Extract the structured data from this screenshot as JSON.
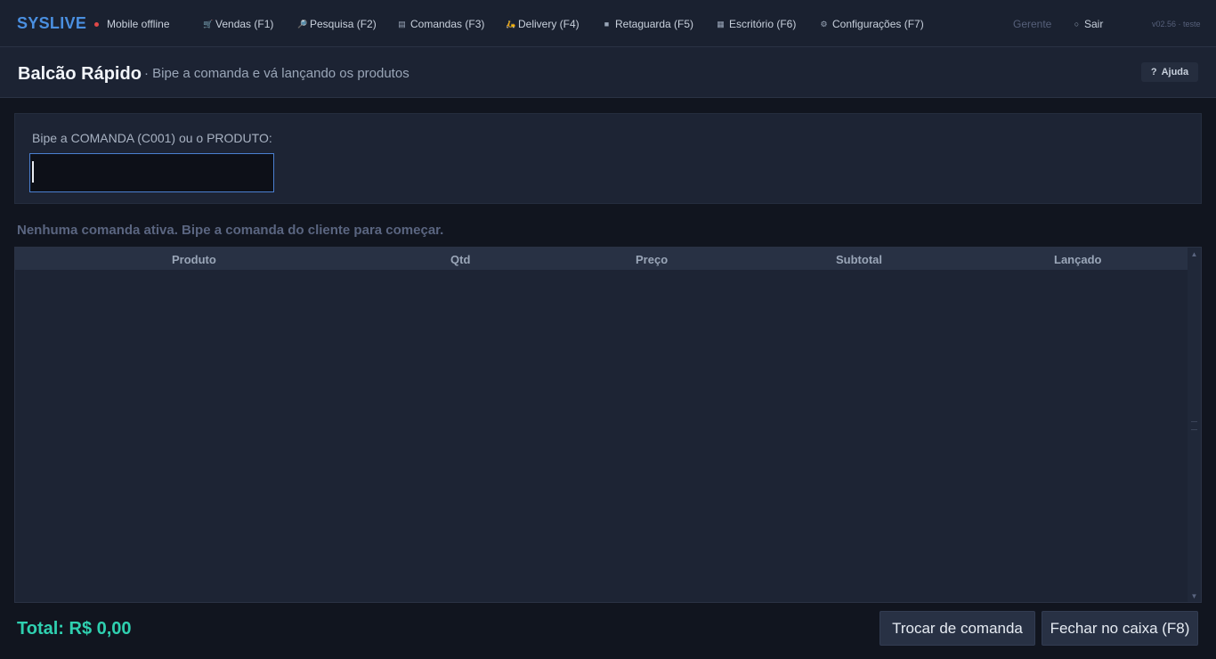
{
  "nav": {
    "brand": "SYSLIVE",
    "status": "Mobile offline",
    "status_color": "#e04848",
    "items": [
      {
        "label": "Vendas (F1)",
        "icon": "cart-icon"
      },
      {
        "label": "Pesquisa (F2)",
        "icon": "search-icon"
      },
      {
        "label": "Comandas (F3)",
        "icon": "clipboard-icon"
      },
      {
        "label": "Delivery (F4)",
        "icon": "scooter-icon"
      },
      {
        "label": "Retaguarda (F5)",
        "icon": "box-icon"
      },
      {
        "label": "Escritório (F6)",
        "icon": "building-icon"
      },
      {
        "label": "Configurações (F7)",
        "icon": "gear-icon"
      }
    ],
    "role": "Gerente",
    "logout": "Sair",
    "version": "v02.56 · teste"
  },
  "header": {
    "title": "Balcão Rápido",
    "subtitle": "· Bipe a comanda e vá lançando os produtos",
    "help": "Ajuda"
  },
  "scan": {
    "label": "Bipe a COMANDA (C001) ou o PRODUTO:",
    "value": ""
  },
  "notice": "Nenhuma comanda ativa. Bipe a comanda do cliente para começar.",
  "table": {
    "columns": [
      "Produto",
      "Qtd",
      "Preço",
      "Subtotal",
      "Lançado"
    ],
    "rows": []
  },
  "footer": {
    "total": "Total: R$ 0,00",
    "swap_button": "Trocar de comanda",
    "close_button": "Fechar no caixa (F8)"
  },
  "colors": {
    "brand": "#4a8fe0",
    "total": "#2fd0b0"
  }
}
